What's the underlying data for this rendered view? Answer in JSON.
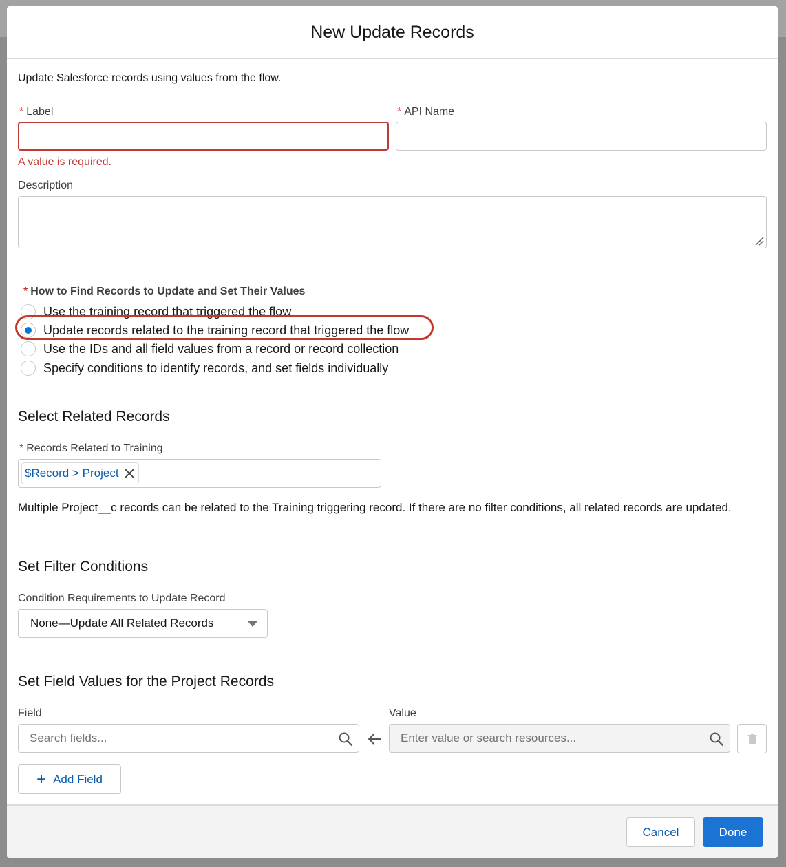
{
  "modal": {
    "title": "New Update Records",
    "intro": "Update Salesforce records using values from the flow."
  },
  "fields": {
    "label_required_marker": "*",
    "label_label": "Label",
    "api_name_label": "API Name",
    "label_value": "",
    "api_name_value": "",
    "label_error": "A value is required.",
    "description_label": "Description",
    "description_value": ""
  },
  "find_records": {
    "heading": "How to Find Records to Update and Set Their Values",
    "options": [
      {
        "label": "Use the training record that triggered the flow",
        "selected": false
      },
      {
        "label": "Update records related to the training record that triggered the flow",
        "selected": true
      },
      {
        "label": "Use the IDs and all field values from a record or record collection",
        "selected": false
      },
      {
        "label": "Specify conditions to identify records, and set fields individually",
        "selected": false
      }
    ],
    "highlight_color": "#c0392b"
  },
  "related": {
    "title": "Select Related Records",
    "field_label": "Records Related to Training",
    "pill_value": "$Record > Project",
    "help_text": "Multiple Project__c records can be related to the Training triggering record. If there are no filter conditions, all related records are updated."
  },
  "filter": {
    "title": "Set Filter Conditions",
    "label": "Condition Requirements to Update Record",
    "selected": "None—Update All Related Records"
  },
  "field_values": {
    "title": "Set Field Values for the Project Records",
    "field_col": "Field",
    "value_col": "Value",
    "field_placeholder": "Search fields...",
    "value_placeholder": "Enter value or search resources...",
    "add_field_label": "Add Field"
  },
  "footer": {
    "cancel": "Cancel",
    "done": "Done"
  },
  "colors": {
    "brand": "#1b74d3",
    "error": "#c23934",
    "link": "#0b5cab"
  }
}
